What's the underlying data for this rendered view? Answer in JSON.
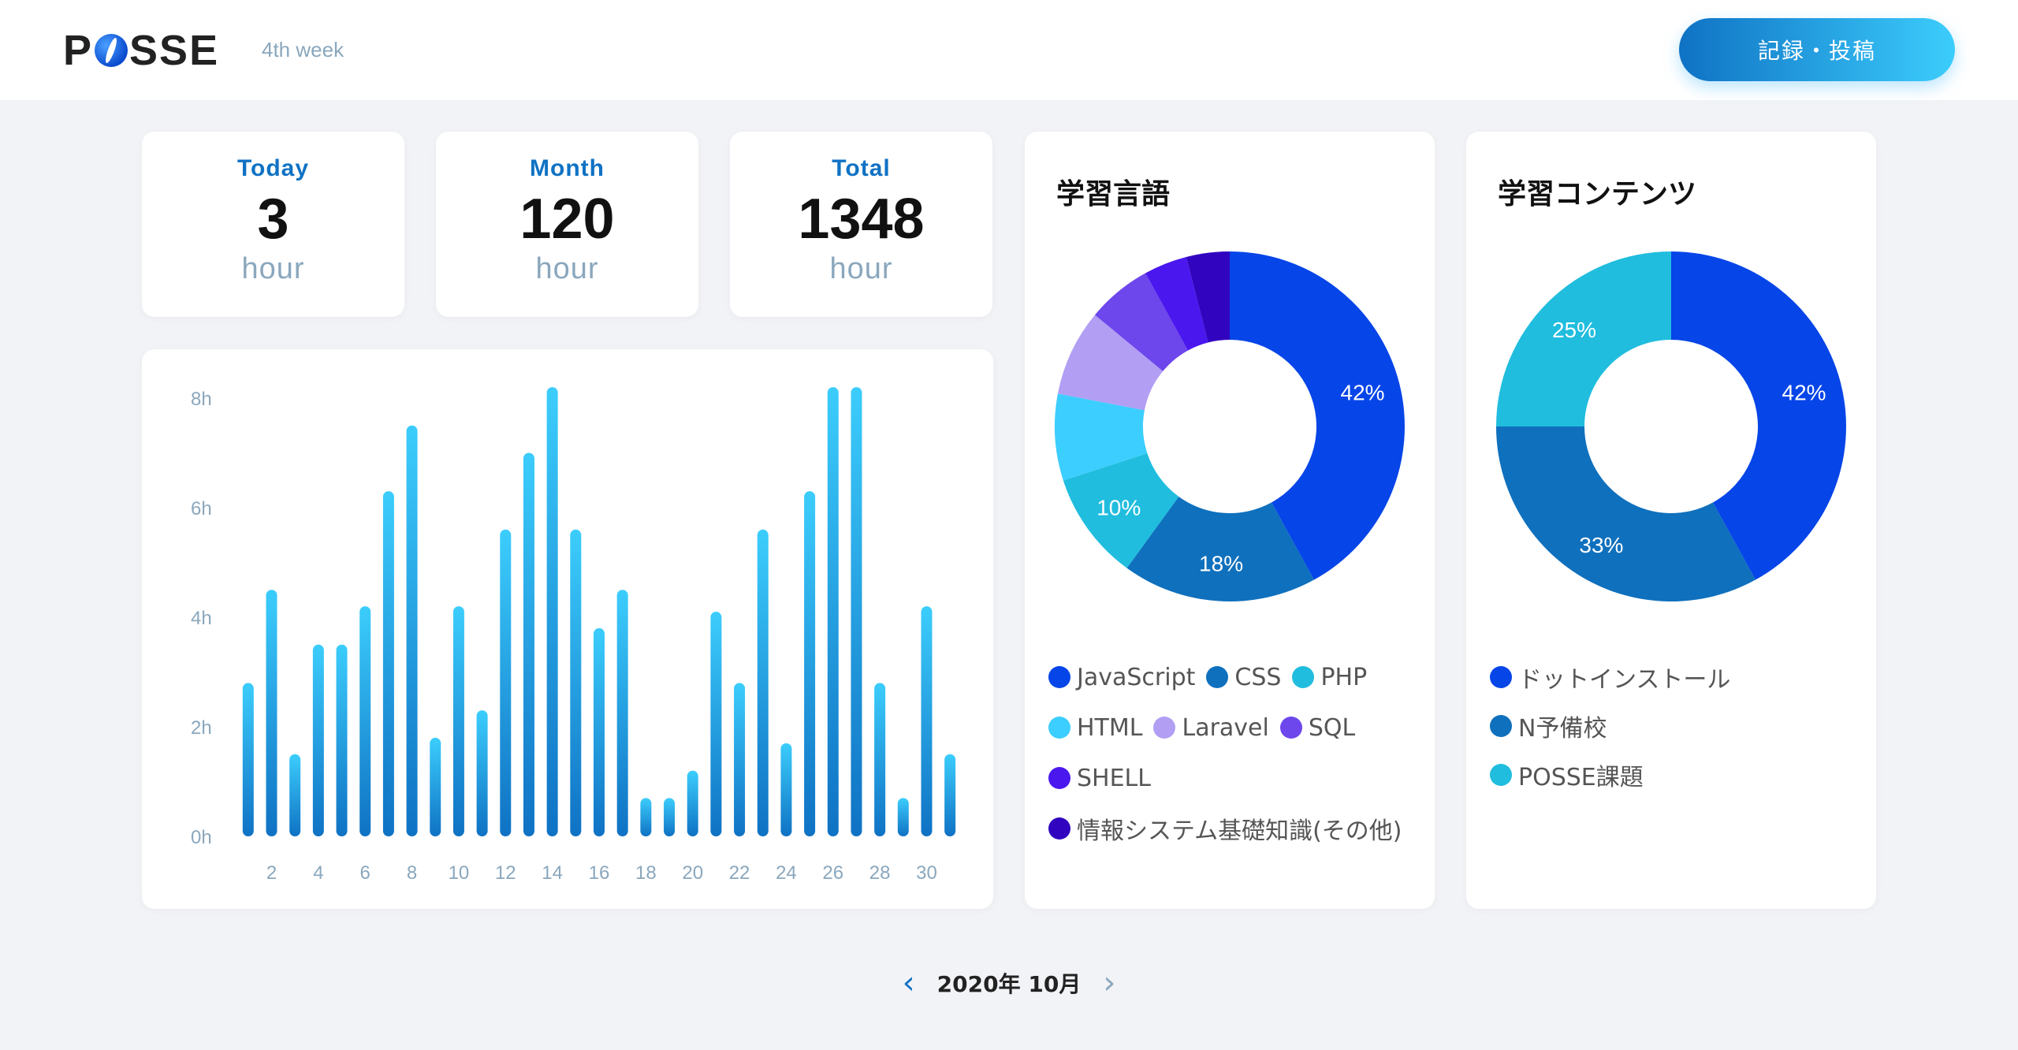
{
  "header": {
    "logo_text_left": "P",
    "logo_text_right": "SSE",
    "week": "4th week",
    "post_button": "記録・投稿"
  },
  "stats": [
    {
      "label": "Today",
      "value": "3",
      "unit": "hour"
    },
    {
      "label": "Month",
      "value": "120",
      "unit": "hour"
    },
    {
      "label": "Total",
      "value": "1348",
      "unit": "hour"
    }
  ],
  "pager": {
    "prev": "‹",
    "month": "2020年 10月",
    "next": "›"
  },
  "colors": {
    "accent": "#0f72c4",
    "bar_top": "#3ccdfc",
    "bar_bottom": "#0f72c4",
    "muted": "#8aa7bd"
  },
  "chart_data": [
    {
      "type": "bar",
      "categories": [
        "1",
        "2",
        "3",
        "4",
        "5",
        "6",
        "7",
        "8",
        "9",
        "10",
        "11",
        "12",
        "13",
        "14",
        "15",
        "16",
        "17",
        "18",
        "19",
        "20",
        "21",
        "22",
        "23",
        "24",
        "25",
        "26",
        "27",
        "28",
        "29",
        "30",
        "31"
      ],
      "values": [
        2.8,
        4.5,
        1.5,
        3.5,
        3.5,
        4.2,
        6.3,
        7.5,
        1.8,
        4.2,
        2.3,
        5.6,
        7.0,
        8.2,
        5.6,
        3.8,
        4.5,
        0.7,
        0.7,
        1.2,
        4.1,
        2.8,
        5.6,
        1.7,
        6.3,
        8.2,
        8.2,
        2.8,
        0.7,
        4.2,
        1.5
      ],
      "x_tick_labels": [
        "2",
        "4",
        "6",
        "8",
        "10",
        "12",
        "14",
        "16",
        "18",
        "20",
        "22",
        "24",
        "26",
        "28",
        "30"
      ],
      "y_tick_labels": [
        "0h",
        "2h",
        "4h",
        "6h",
        "8h"
      ],
      "ylim": [
        0,
        8
      ],
      "xlabel": "",
      "ylabel": "",
      "grid": false
    },
    {
      "type": "pie",
      "title": "学習言語",
      "donut": true,
      "slices": [
        {
          "label": "JavaScript",
          "value": 42,
          "color": "#0645e8",
          "show_pct": "42%"
        },
        {
          "label": "CSS",
          "value": 18,
          "color": "#0f70bd",
          "show_pct": "18%"
        },
        {
          "label": "PHP",
          "value": 10,
          "color": "#20bdde",
          "show_pct": "10%"
        },
        {
          "label": "HTML",
          "value": 8,
          "color": "#3ccefe",
          "show_pct": ""
        },
        {
          "label": "Laravel",
          "value": 8,
          "color": "#b29ef3",
          "show_pct": ""
        },
        {
          "label": "SQL",
          "value": 6,
          "color": "#6d46ec",
          "show_pct": ""
        },
        {
          "label": "SHELL",
          "value": 4,
          "color": "#4a17ef",
          "show_pct": ""
        },
        {
          "label": "情報システム基礎知識(その他)",
          "value": 4,
          "color": "#3105c0",
          "show_pct": ""
        }
      ]
    },
    {
      "type": "pie",
      "title": "学習コンテンツ",
      "donut": true,
      "slices": [
        {
          "label": "ドットインストール",
          "value": 42,
          "color": "#0645e8",
          "show_pct": "42%"
        },
        {
          "label": "N予備校",
          "value": 33,
          "color": "#0f70bd",
          "show_pct": "33%"
        },
        {
          "label": "POSSE課題",
          "value": 25,
          "color": "#20bdde",
          "show_pct": "25%"
        }
      ]
    }
  ]
}
